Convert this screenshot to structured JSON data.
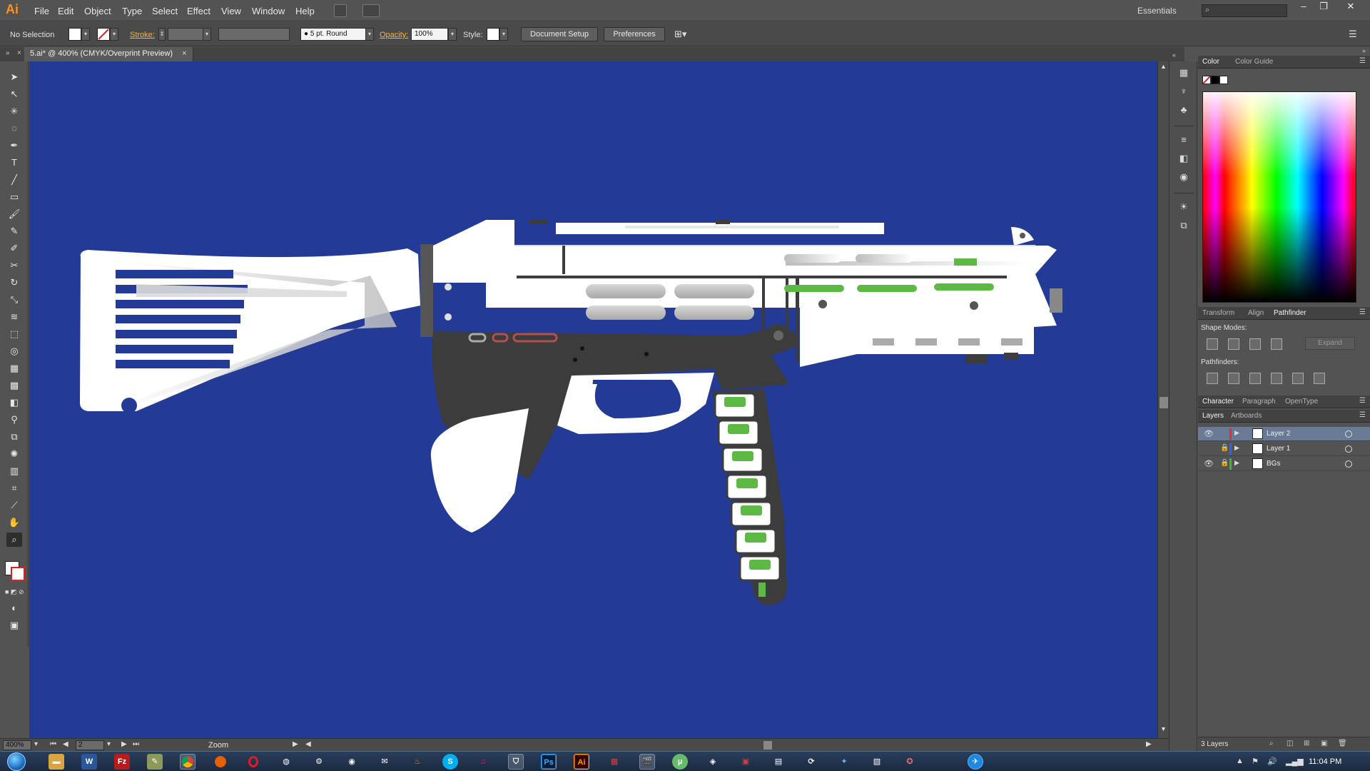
{
  "app": {
    "logo": "Ai",
    "menus": [
      "File",
      "Edit",
      "Object",
      "Type",
      "Select",
      "Effect",
      "View",
      "Window",
      "Help"
    ],
    "workspace": "Essentials",
    "window_controls": [
      "–",
      "❐",
      "✕"
    ]
  },
  "control_bar": {
    "selection_label": "No Selection",
    "stroke_label": "Stroke:",
    "brush_label": "5 pt. Round",
    "opacity_label": "Opacity:",
    "opacity_value": "100%",
    "style_label": "Style:",
    "document_setup": "Document Setup",
    "preferences": "Preferences"
  },
  "document": {
    "tab_title": "5.ai* @ 400% (CMYK/Overprint Preview)",
    "tab_close": "×"
  },
  "status_bar": {
    "zoom_value": "400%",
    "artboard_value": "2",
    "status_label": "Zoom"
  },
  "panels": {
    "color_tabs": [
      "Color",
      "Color Guide"
    ],
    "pathfinder_tabs": [
      "Transform",
      "Align",
      "Pathfinder"
    ],
    "shape_modes_label": "Shape Modes:",
    "pathfinders_label": "Pathfinders:",
    "expand_label": "Expand",
    "character_tabs": [
      "Character",
      "Paragraph",
      "OpenType"
    ],
    "layers_tabs": [
      "Layers",
      "Artboards"
    ],
    "layers": [
      {
        "name": "Layer 2",
        "color": "#e03030",
        "selected": true,
        "locked": false,
        "visible": true
      },
      {
        "name": "Layer 1",
        "color": "#3a5cff",
        "selected": false,
        "locked": true,
        "visible": false
      },
      {
        "name": "BGs",
        "color": "#30c030",
        "selected": false,
        "locked": true,
        "visible": true
      }
    ],
    "layers_count": "3 Layers"
  },
  "colors": {
    "canvas_bg": "#233b97",
    "accent_green": "#5cb944",
    "gun_dark": "#3c3c3c"
  },
  "taskbar": {
    "clock": "11:04 PM",
    "apps": [
      "explorer",
      "word",
      "filezilla",
      "notepad",
      "chrome",
      "firefox",
      "opera",
      "globe",
      "steam",
      "media",
      "mail",
      "fire",
      "skype",
      "itunes",
      "fox",
      "Ps",
      "Ai",
      "film",
      "clapper",
      "utorrent",
      "app1",
      "app2",
      "app3",
      "app4",
      "app5",
      "app6",
      "app7",
      "messenger"
    ]
  }
}
